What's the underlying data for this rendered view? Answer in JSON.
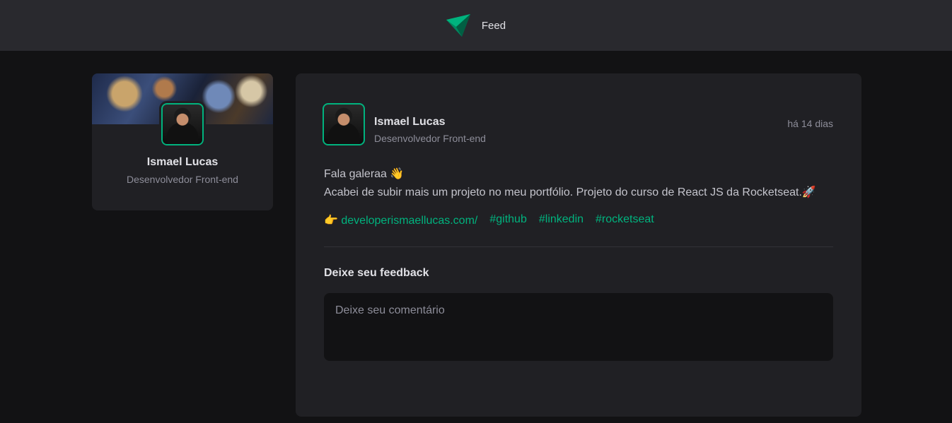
{
  "header": {
    "title": "Feed",
    "logo_icon": "ignite-logo-icon"
  },
  "colors": {
    "accent": "#00b37e",
    "surface": "#202024",
    "background": "#121214",
    "header": "#29292e"
  },
  "profile": {
    "name": "Ismael Lucas",
    "role": "Desenvolvedor Front-end"
  },
  "post": {
    "author": {
      "name": "Ismael Lucas",
      "role": "Desenvolvedor Front-end"
    },
    "time": "há 14 dias",
    "paragraphs": [
      "Fala galeraa 👋",
      "Acabei de subir mais um projeto no meu portfólio. Projeto do curso de React JS da Rocketseat.🚀"
    ],
    "link_emoji": "👉",
    "link": "developerismaellucas.com/",
    "hashtags": [
      "#github",
      "#linkedin",
      "#rocketseat"
    ]
  },
  "feedback": {
    "title": "Deixe seu feedback",
    "placeholder": "Deixe seu comentário"
  }
}
